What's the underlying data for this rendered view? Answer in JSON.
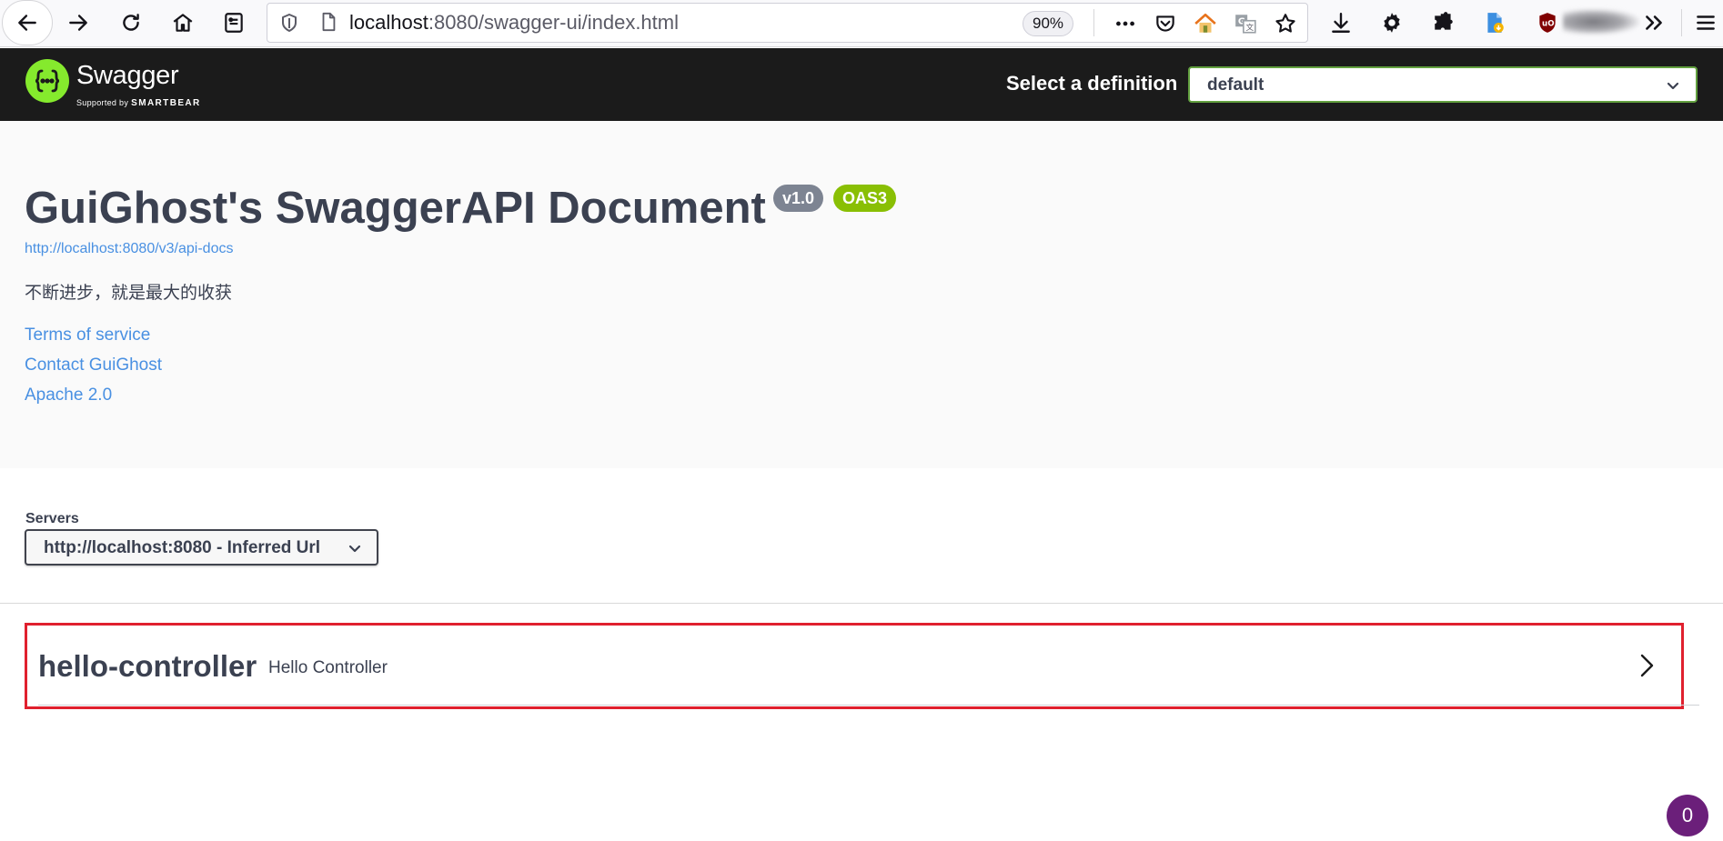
{
  "browser": {
    "url_host": "localhost",
    "url_rest": ":8080/swagger-ui/index.html",
    "zoom": "90%",
    "toolbar_icons": [
      "back-icon",
      "forward-icon",
      "reload-icon",
      "home-icon",
      "reader-icon",
      "shield-icon",
      "page-icon",
      "more-icon",
      "pocket-icon",
      "house-addon-icon",
      "translate-icon",
      "bookmark-star-icon",
      "download-icon",
      "gear-icon",
      "extensions-icon",
      "file-addon-icon",
      "ublock-icon",
      "account-icon",
      "overflow-icon",
      "menu-icon"
    ]
  },
  "topbar": {
    "logo_word": "Swagger",
    "logo_sub_prefix": "Supported by",
    "logo_sub_brand": "SMARTBEAR",
    "definition_label": "Select a definition",
    "definition_value": "default"
  },
  "info": {
    "title": "GuiGhost's SwaggerAPI Document",
    "version_badge": "v1.0",
    "spec_badge": "OAS3",
    "spec_url": "http://localhost:8080/v3/api-docs",
    "description": "不断进步，就是最大的收获",
    "links": {
      "terms": "Terms of service",
      "contact": "Contact GuiGhost",
      "license": "Apache 2.0"
    }
  },
  "servers": {
    "label": "Servers",
    "selected": "http://localhost:8080 - Inferred Url"
  },
  "tags": [
    {
      "name": "hello-controller",
      "description": "Hello Controller"
    }
  ],
  "counter_badge": "0",
  "colors": {
    "swagger_green": "#85ea2d",
    "link_blue": "#4990e2",
    "text_dark": "#3b4151",
    "highlight_red": "#e0202e",
    "badge_gray": "#7d8492",
    "badge_green": "#89bf04"
  }
}
